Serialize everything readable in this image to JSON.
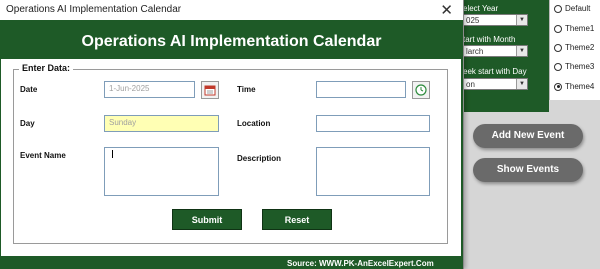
{
  "window": {
    "title": "Operations AI Implementation Calendar",
    "close_glyph": "✕"
  },
  "banner": {
    "title": "Operations AI Implementation Calendar"
  },
  "form": {
    "group_caption": "Enter Data:",
    "date": {
      "label": "Date",
      "value": "1-Jun-2025"
    },
    "time": {
      "label": "Time",
      "value": ""
    },
    "day": {
      "label": "Day",
      "value": "Sunday"
    },
    "location": {
      "label": "Location",
      "value": ""
    },
    "event_name": {
      "label": "Event Name",
      "value": ""
    },
    "description": {
      "label": "Description",
      "value": ""
    },
    "submit_label": "Submit",
    "reset_label": "Reset"
  },
  "footer": {
    "source": "Source: WWW.PK-AnExcelExpert.Com"
  },
  "sheet": {
    "select_year_label": "elect Year",
    "year_value": "025",
    "start_month_label": "tart with Month",
    "month_value": "larch",
    "week_start_label": "eek start with Day",
    "week_value": "on",
    "themes": [
      "Default",
      "Theme1",
      "Theme2",
      "Theme3",
      "Theme4"
    ],
    "selected_theme": "Theme4",
    "add_event_label": "Add New Event",
    "show_events_label": "Show Events"
  },
  "colors": {
    "brand_green": "#1e5a27",
    "day_highlight": "#ffffb4",
    "pill_gray": "#6a6a6a"
  },
  "icons": {
    "calendar": "calendar-icon",
    "clock": "clock-icon",
    "dropdown": "chevron-down-icon"
  }
}
